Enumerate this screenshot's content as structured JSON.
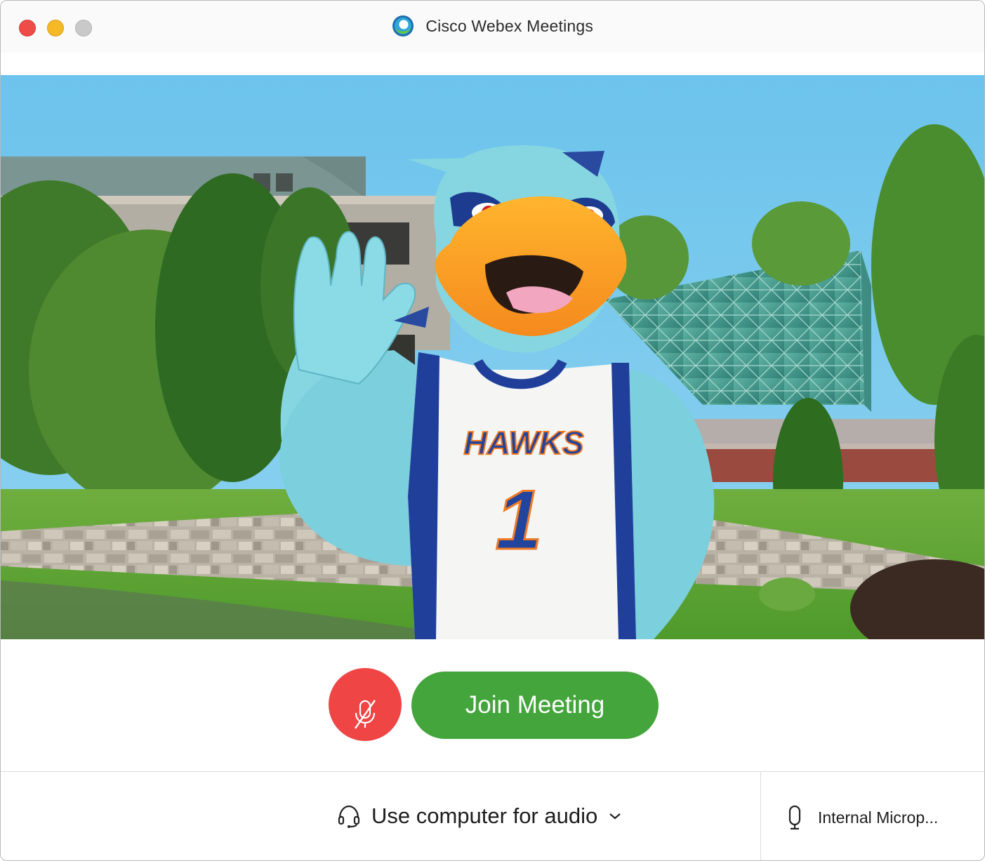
{
  "window": {
    "title": "Cisco Webex Meetings"
  },
  "preview": {
    "jersey_text": "HAWKS",
    "jersey_number": "1"
  },
  "controls": {
    "mute_state": "muted",
    "join_label": "Join Meeting"
  },
  "audio": {
    "connection_label": "Use computer for audio",
    "microphone_label": "Internal Microp..."
  },
  "colors": {
    "mute_red": "#ef4545",
    "join_green": "#43a53b",
    "sky": "#74c6ea",
    "mascot_blue": "#86d6e2"
  },
  "icons": {
    "close": "close-window-icon",
    "minimize": "minimize-window-icon",
    "zoom": "zoom-window-icon",
    "logo": "webex-logo-icon",
    "mute": "microphone-muted-icon",
    "audio": "headset-icon",
    "chevron": "chevron-down-icon",
    "mic": "microphone-icon"
  }
}
